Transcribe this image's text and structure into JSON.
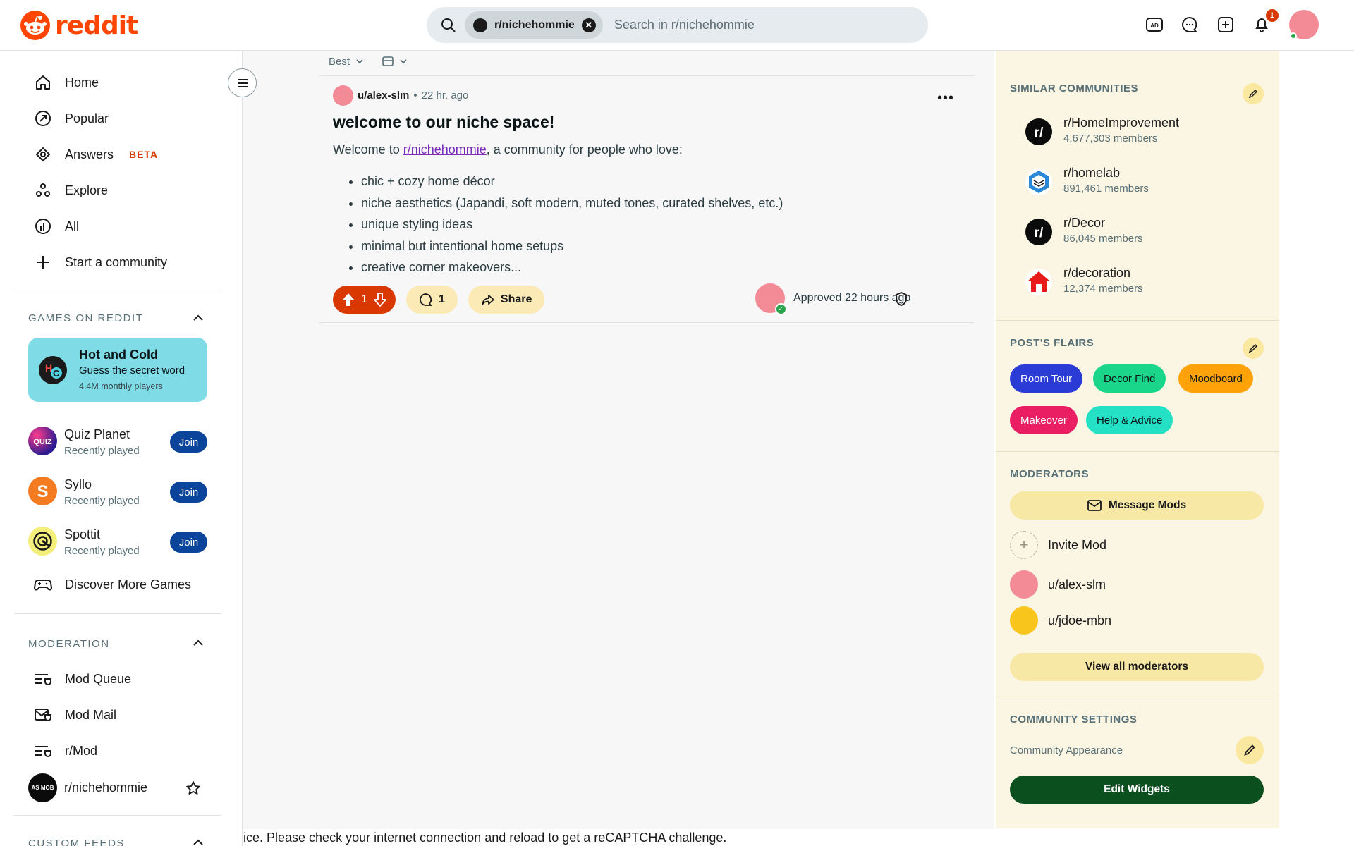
{
  "header": {
    "logo_text": "reddit",
    "search_chip": "r/nichehommie",
    "search_placeholder": "Search in r/nichehommie",
    "notification_count": "1",
    "icons": [
      "ads-icon",
      "chat-icon",
      "create-post-icon",
      "bell-icon"
    ]
  },
  "nav": {
    "home": "Home",
    "popular": "Popular",
    "answers": "Answers",
    "answers_badge": "BETA",
    "explore": "Explore",
    "all": "All",
    "start_community": "Start a community"
  },
  "games": {
    "section_title": "GAMES ON REDDIT",
    "featured": {
      "title": "Hot and Cold",
      "subtitle": "Guess the secret word",
      "players": "4.4M monthly players"
    },
    "list": [
      {
        "name": "Quiz Planet",
        "status": "Recently played",
        "action": "Join"
      },
      {
        "name": "Syllo",
        "status": "Recently played",
        "action": "Join"
      },
      {
        "name": "Spottit",
        "status": "Recently played",
        "action": "Join"
      }
    ],
    "discover": "Discover More Games"
  },
  "moderation": {
    "section_title": "MODERATION",
    "items": [
      "Mod Queue",
      "Mod Mail",
      "r/Mod",
      "r/nichehommie"
    ]
  },
  "custom_feeds_title": "CUSTOM FEEDS",
  "sort": {
    "label": "Best"
  },
  "post": {
    "author": "u/alex-slm",
    "separator": "•",
    "time": "22 hr. ago",
    "title": "welcome to our niche space!",
    "intro_prefix": "Welcome to ",
    "intro_link": "r/nichehommie",
    "intro_suffix": ", a community for people who love:",
    "bullets": [
      "chic + cozy home décor",
      "niche aesthetics (Japandi, soft modern, muted tones, curated shelves, etc.)",
      "unique styling ideas",
      "minimal but intentional home setups",
      "creative corner makeovers..."
    ],
    "votes": "1",
    "comments": "1",
    "share_label": "Share",
    "approved": "Approved 22 hours ago"
  },
  "similar": {
    "title": "SIMILAR COMMUNITIES",
    "items": [
      {
        "name": "r/HomeImprovement",
        "members": "4,677,303 members"
      },
      {
        "name": "r/homelab",
        "members": "891,461 members"
      },
      {
        "name": "r/Decor",
        "members": "86,045 members"
      },
      {
        "name": "r/decoration",
        "members": "12,374 members"
      }
    ]
  },
  "flairs": {
    "title": "POST'S FLAIRS",
    "items": [
      {
        "label": "Room Tour",
        "bg": "#2a3bd6",
        "fg": "#ffffff"
      },
      {
        "label": "Decor Find",
        "bg": "#19d68a",
        "fg": "#0b1416"
      },
      {
        "label": "Moodboard",
        "bg": "#ffa20a",
        "fg": "#0b1416"
      },
      {
        "label": "Makeover",
        "bg": "#ea1e63",
        "fg": "#ffffff"
      },
      {
        "label": "Help & Advice",
        "bg": "#24e1c6",
        "fg": "#0b1416"
      }
    ]
  },
  "moderators": {
    "title": "MODERATORS",
    "message_btn": "Message Mods",
    "invite": "Invite Mod",
    "list": [
      "u/alex-slm",
      "u/jdoe-mbn"
    ],
    "view_all": "View all moderators"
  },
  "community_settings": {
    "title": "COMMUNITY SETTINGS",
    "appearance": "Community Appearance",
    "edit_widgets": "Edit Widgets"
  },
  "footer_notice": "ice. Please check your internet connection and reload to get a reCAPTCHA challenge."
}
